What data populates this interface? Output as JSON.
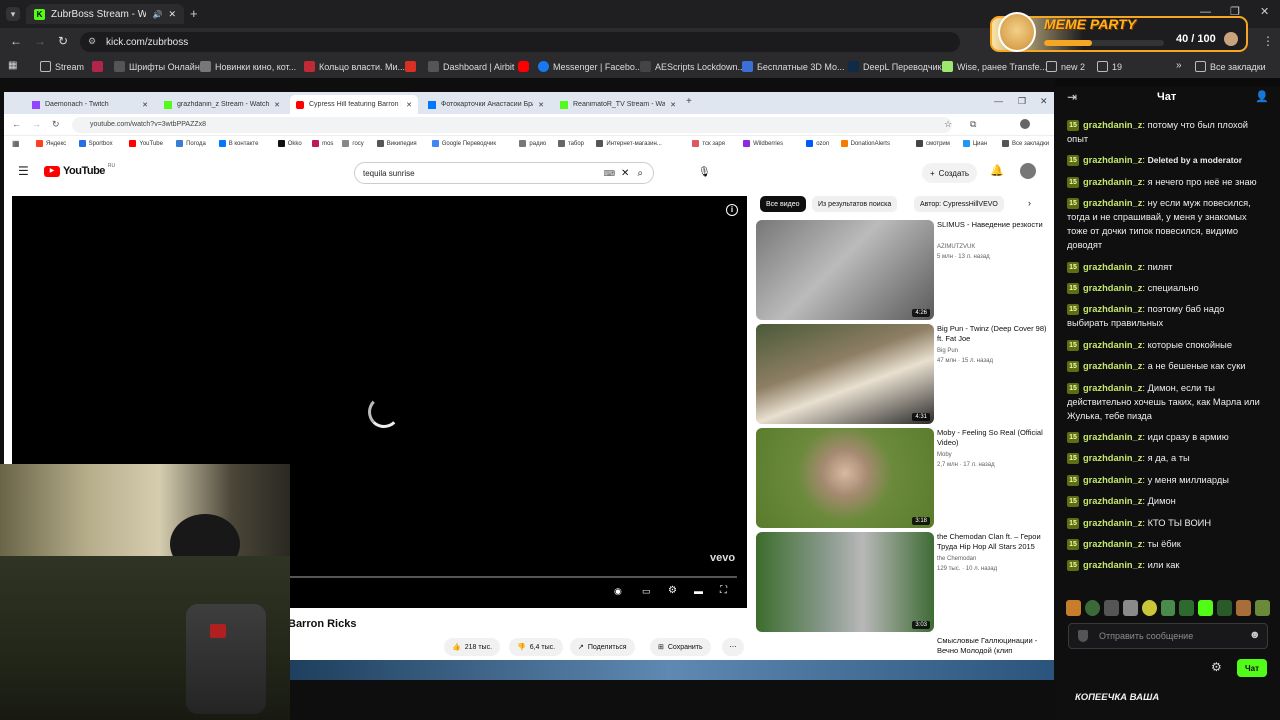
{
  "outer_browser": {
    "active_tab": "ZubrBoss Stream - Watch L",
    "url": "kick.com/zubrboss",
    "bookmarks": [
      "Stream",
      "Шрифты Онлайн",
      "Новинки кино, кот...",
      "Кольцо власти. Ми...",
      "Dashboard | Airbit",
      "Messenger | Facebo...",
      "AEScripts Lockdown...",
      "Бесплатные 3D Мо...",
      "DeepL Переводчик",
      "Wise, ранее Transfe...",
      "new 2",
      "19",
      "Все закладки"
    ]
  },
  "meme_party": {
    "title": "MEME PARTY",
    "progress": "40 / 100",
    "fill_fraction": 0.4
  },
  "inner_browser": {
    "tabs": [
      "Daemonach - Twitch",
      "grazhdanin_z Stream - Watch L",
      "Cypress Hill featuring Barron R",
      "Фотокарточки Анастасии Бра",
      "ReanimatoR_TV Stream - Watch"
    ],
    "url": "youtube.com/watch?v=3wtbPPAZZx8",
    "bookmarks": [
      "Яндекс",
      "Sportbox",
      "YouTube",
      "Погода",
      "В контакте",
      "Okko",
      "mos",
      "госу",
      "Википедия",
      "Google Переводчик",
      "радио",
      "табор",
      "Интернет-магазин...",
      "тск заря",
      "Wildberries",
      "ozon",
      "DonationAlerts",
      "смотрим",
      "Циан",
      "Все закладки"
    ]
  },
  "youtube": {
    "logo": "YouTube",
    "logo_sup": "RU",
    "search_value": "tequila sunrise",
    "create_label": "Создать",
    "player_watermark": "vevo",
    "video_title_fragment": "Barron Ricks",
    "like_count": "218 тыс.",
    "dislike_count": "6,4 тыс.",
    "share_label": "Поделиться",
    "save_label": "Сохранить",
    "chips": [
      "Все видео",
      "Из результатов поиска",
      "Автор: CypressHillVEVO"
    ],
    "recommendations": [
      {
        "title": "SLIMUS - Наведение резкости",
        "channel": "AZIMUTZVUK",
        "meta": "5 млн · 13 л. назад",
        "duration": "4:26"
      },
      {
        "title": "Big Pun - Twinz (Deep Cover 98) ft. Fat Joe",
        "channel": "Big Pun",
        "meta": "47 млн · 15 л. назад",
        "duration": "4:31"
      },
      {
        "title": "Moby - Feeling So Real (Official Video)",
        "channel": "Moby",
        "meta": "2,7 млн · 17 л. назад",
        "duration": "3:18"
      },
      {
        "title": "the Chemodan Clan ft. – Герои Труда Hip Hop All Stars 2015",
        "channel": "the Chemodan",
        "meta": "129 тыс. · 10 л. назад",
        "duration": "3:03"
      }
    ],
    "partial_rec_title": "Смысловые Галлюцинации - Вечно Молодой (клип"
  },
  "chat": {
    "title": "Чат",
    "badge": "15",
    "messages": [
      {
        "user": "grazhdanin_z",
        "text": "потому что был плохой опыт"
      },
      {
        "user": "grazhdanin_z",
        "text": "Deleted by a moderator"
      },
      {
        "user": "grazhdanin_z",
        "text": "я нечего про неё не знаю"
      },
      {
        "user": "grazhdanin_z",
        "text": "ну если муж повесился, тогда и не спрашивай, у меня у знакомых тоже от дочки типок повесился, видимо доводят"
      },
      {
        "user": "grazhdanin_z",
        "text": "пилят"
      },
      {
        "user": "grazhdanin_z",
        "text": "специально"
      },
      {
        "user": "grazhdanin_z",
        "text": "поэтому баб надо выбирать правильных"
      },
      {
        "user": "grazhdanin_z",
        "text": "которые спокойные"
      },
      {
        "user": "grazhdanin_z",
        "text": "а не бешеные как суки"
      },
      {
        "user": "grazhdanin_z",
        "text": "Димон, если ты действительно хочешь таких, как Марла или Жулька, тебе пизда"
      },
      {
        "user": "grazhdanin_z",
        "text": "иди сразу в армию"
      },
      {
        "user": "grazhdanin_z",
        "text": "я да, а ты"
      },
      {
        "user": "grazhdanin_z",
        "text": "у меня миллиарды"
      },
      {
        "user": "grazhdanin_z",
        "text": "Димон"
      },
      {
        "user": "grazhdanin_z",
        "text": "КТО ТЫ ВОИН"
      },
      {
        "user": "grazhdanin_z",
        "text": "ты ёбик"
      },
      {
        "user": "grazhdanin_z",
        "text": "или как"
      }
    ],
    "input_placeholder": "Отправить сообщение",
    "send_label": "Чат"
  },
  "bottom_caption": "КОПЕЕЧКА ВАША",
  "colors": {
    "kick_green": "#53fc18",
    "chat_user": "#c5e86c",
    "youtube_red": "#ff0000"
  }
}
